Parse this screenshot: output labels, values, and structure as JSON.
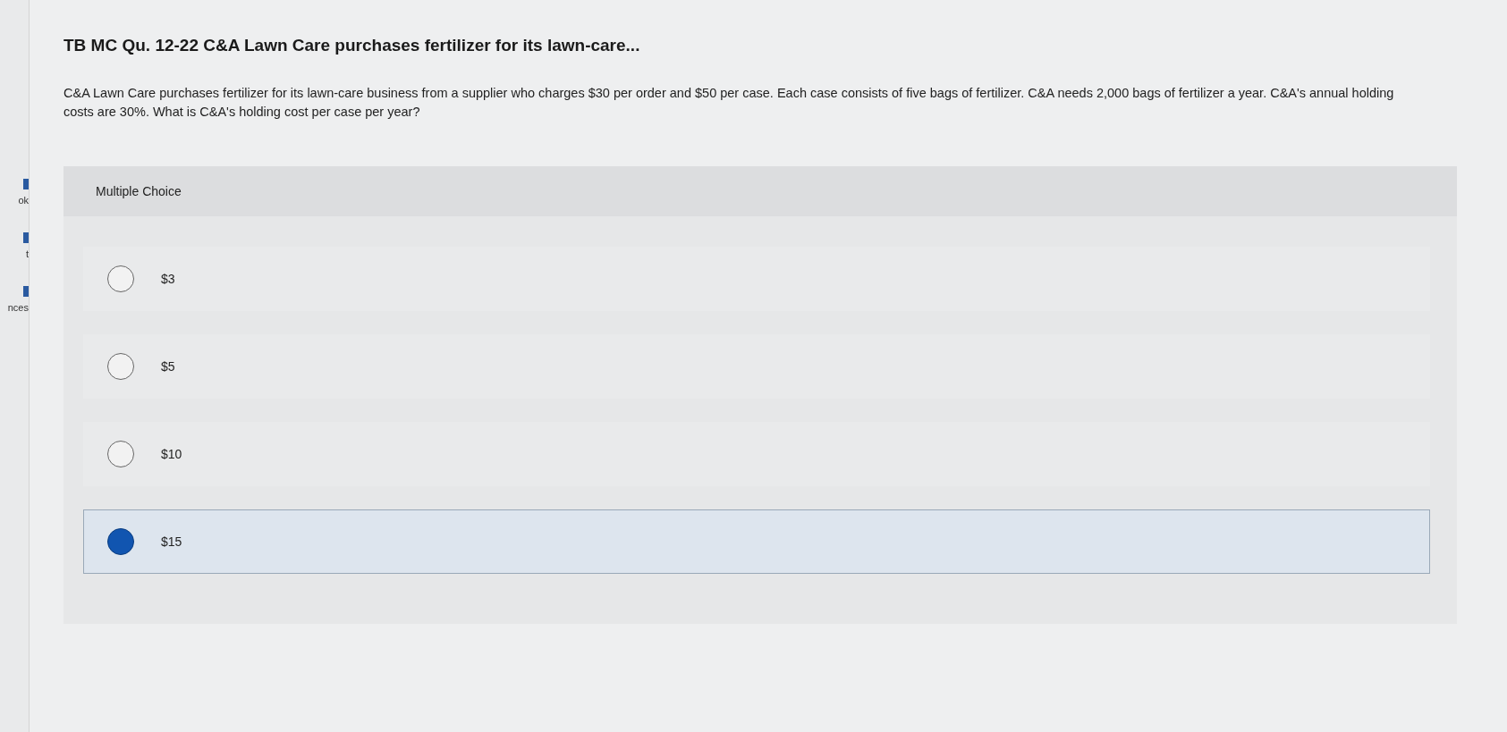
{
  "sidebar": {
    "items": [
      {
        "label": "ok"
      },
      {
        "label": "t"
      },
      {
        "label": "nces"
      }
    ]
  },
  "title": "TB MC Qu. 12-22 C&A Lawn Care purchases fertilizer for its lawn-care...",
  "question": "C&A Lawn Care purchases fertilizer for its lawn-care business from a supplier who charges $30 per order and $50 per case. Each case consists of five bags of fertilizer. C&A needs 2,000 bags of fertilizer a year. C&A's annual holding costs are 30%. What is C&A's holding cost per case per year?",
  "multiple_choice": {
    "heading": "Multiple Choice",
    "options": [
      {
        "label": "$3",
        "selected": false
      },
      {
        "label": "$5",
        "selected": false
      },
      {
        "label": "$10",
        "selected": false
      },
      {
        "label": "$15",
        "selected": true
      }
    ]
  }
}
